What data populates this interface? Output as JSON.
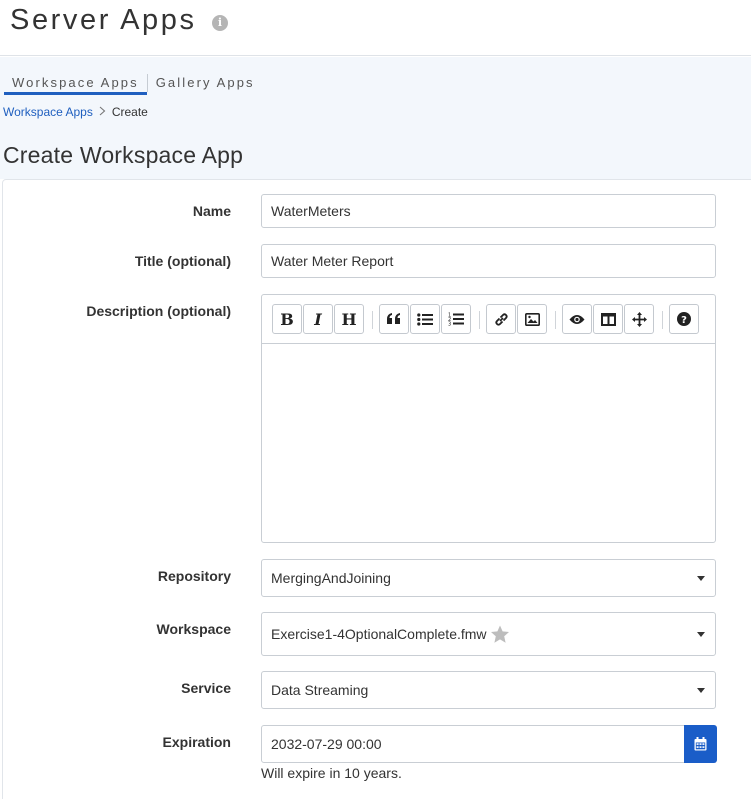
{
  "header": {
    "title": "Server Apps",
    "info_icon": "info-circle-icon"
  },
  "tabs": [
    {
      "label": "Workspace Apps",
      "active": true
    },
    {
      "label": "Gallery Apps",
      "active": false
    }
  ],
  "breadcrumb": {
    "parent": "Workspace Apps",
    "current": "Create"
  },
  "section_title": "Create Workspace App",
  "form": {
    "name": {
      "label": "Name",
      "value": "WaterMeters"
    },
    "title": {
      "label": "Title (optional)",
      "value": "Water Meter Report"
    },
    "description": {
      "label": "Description (optional)",
      "value": "",
      "toolbar": [
        {
          "name": "bold",
          "icon": "bold-icon",
          "glyph": "B"
        },
        {
          "name": "italic",
          "icon": "italic-icon",
          "glyph": "I"
        },
        {
          "name": "heading",
          "icon": "heading-icon",
          "glyph": "H"
        },
        {
          "name": "quote",
          "icon": "quote-icon"
        },
        {
          "name": "unordered-list",
          "icon": "unordered-list-icon"
        },
        {
          "name": "ordered-list",
          "icon": "ordered-list-icon"
        },
        {
          "name": "link",
          "icon": "link-icon"
        },
        {
          "name": "image",
          "icon": "image-icon"
        },
        {
          "name": "preview",
          "icon": "eye-icon"
        },
        {
          "name": "side-by-side",
          "icon": "columns-icon"
        },
        {
          "name": "fullscreen",
          "icon": "arrows-move-icon"
        },
        {
          "name": "guide",
          "icon": "question-circle-icon"
        }
      ]
    },
    "repository": {
      "label": "Repository",
      "value": "MergingAndJoining"
    },
    "workspace": {
      "label": "Workspace",
      "value": "Exercise1-4OptionalComplete.fmw",
      "favorite_icon": "star-icon"
    },
    "service": {
      "label": "Service",
      "value": "Data Streaming"
    },
    "expiration": {
      "label": "Expiration",
      "value": "2032-07-29 00:00",
      "help": "Will expire in 10 years.",
      "calendar_icon": "calendar-icon"
    }
  },
  "colors": {
    "accent": "#1a5dc8",
    "link": "#1f5fbf",
    "subheader_bg": "#f3f7fc"
  }
}
